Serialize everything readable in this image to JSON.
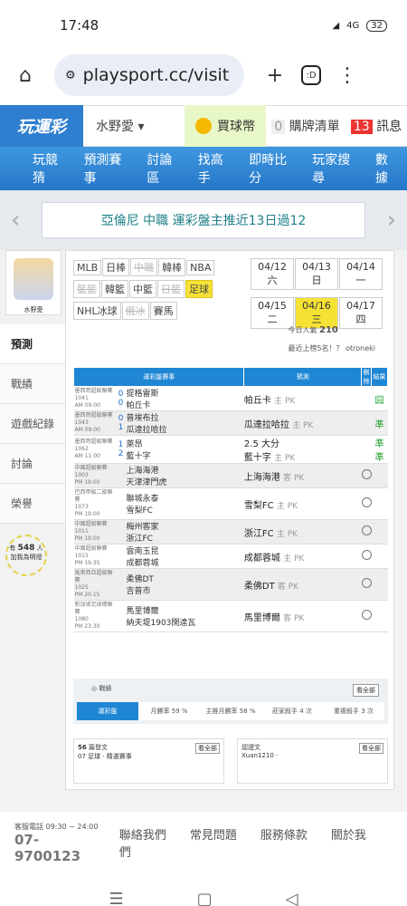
{
  "status": {
    "time": "17:48",
    "battery": "32",
    "net": "4G"
  },
  "browser": {
    "url": "playsport.cc/visit",
    "tab": ":D"
  },
  "site": {
    "logo": "玩運彩",
    "user": "水野愛",
    "coin": "買球幣",
    "cart_count": "0",
    "cart": "購牌清單",
    "msg_count": "13",
    "msg": "訊息"
  },
  "nav": [
    "玩競猜",
    "預測賽事",
    "討論區",
    "找高手",
    "即時比分",
    "玩家搜尋",
    "數據"
  ],
  "banner": {
    "text": "亞倫尼 中職 運彩盤主推近13日過12"
  },
  "side": {
    "name": "水野愛",
    "items": [
      "預測",
      "戰績",
      "遊戲紀錄",
      "討論",
      "榮譽"
    ],
    "bulb_top": "有",
    "bulb_count": "548",
    "bulb_unit": "人",
    "bulb_bottom": "加我為明燈"
  },
  "leagues": [
    {
      "n": "MLB"
    },
    {
      "n": "日棒"
    },
    {
      "n": "中職",
      "dis": true
    },
    {
      "n": "韓棒"
    },
    {
      "n": "NBA"
    },
    {
      "n": "籃籃",
      "dis": true
    },
    {
      "n": "韓籃"
    },
    {
      "n": "中籃"
    },
    {
      "n": "日籃",
      "dis": true
    },
    {
      "n": "足球",
      "y": true
    },
    {
      "n": "NHL冰球"
    },
    {
      "n": "俄冰",
      "dis": true
    },
    {
      "n": "賽馬"
    }
  ],
  "dates": [
    {
      "d": "04/12 六"
    },
    {
      "d": "04/13 日"
    },
    {
      "d": "04/14 一"
    },
    {
      "d": "04/15 二"
    },
    {
      "d": "04/16 三",
      "y": true
    },
    {
      "d": "04/17 四"
    }
  ],
  "pop": {
    "label": "今日人氣",
    "value": "210",
    "label2": "最近上榜5名！？ otroneki"
  },
  "table": {
    "h1": "運彩盤賽事",
    "h2": "預測",
    "h3": "刪除",
    "h4": "結果",
    "rows": [
      {
        "lg": "墨西哥超級聯賽",
        "code": "1041",
        "time": "AM 09:00",
        "n1": "0",
        "n2": "0",
        "a": "提格雷斯",
        "b": "帕丘卡",
        "pick": "帕丘卡",
        "side": "主 PK",
        "res": "囧",
        "gray": false
      },
      {
        "lg": "墨西哥超級聯賽",
        "code": "1043",
        "time": "AM 09:00",
        "n1": "0",
        "n2": "1",
        "a": "普埃布拉",
        "b": "瓜達拉哈拉",
        "pick": "瓜達拉哈拉",
        "side": "主 PK",
        "res": "準",
        "gray": true
      },
      {
        "lg": "墨西哥超級聯賽",
        "code": "1062",
        "time": "AM 11:00",
        "n1": "1",
        "n2": "2",
        "a": "萊昂",
        "b": "藍十字",
        "pick": "2.5 大分",
        "pick2": "藍十字",
        "side": "主 PK",
        "res": "準",
        "res2": "準",
        "gray": false
      },
      {
        "lg": "中國超級聯賽",
        "code": "1003",
        "time": "PM 19:00",
        "n1": "",
        "n2": "",
        "a": "上海海港",
        "b": "天津津門虎",
        "pick": "上海海港",
        "side": "客 PK",
        "res": "o",
        "gray": true
      },
      {
        "lg": "巴西甲級二級聯賽",
        "code": "1073",
        "time": "PM 19:00",
        "n1": "",
        "n2": "",
        "a": "聯城永泰",
        "b": "雪梨FC",
        "pick": "雪梨FC",
        "side": "主 PK",
        "res": "o",
        "gray": false
      },
      {
        "lg": "中國超級聯賽",
        "code": "1011",
        "time": "PM 19:00",
        "n1": "",
        "n2": "",
        "a": "梅州客家",
        "b": "浙江FC",
        "pick": "浙江FC",
        "side": "主 PK",
        "res": "o",
        "gray": true
      },
      {
        "lg": "中國超級聯賽",
        "code": "1015",
        "time": "PM 19:35",
        "n1": "",
        "n2": "",
        "a": "雲南玉昆",
        "b": "成都蓉城",
        "pick": "成都蓉城",
        "side": "主 PK",
        "res": "o",
        "gray": false
      },
      {
        "lg": "馬來西亞超級聯賽",
        "code": "1025",
        "time": "PM 20:15",
        "n1": "",
        "n2": "",
        "a": "柔佛DT",
        "b": "吉普市",
        "pick": "柔佛DT",
        "side": "客 PK",
        "res": "o",
        "gray": true
      },
      {
        "lg": "新加坡足球總聯賽",
        "code": "1080",
        "time": "PM 23:30",
        "n1": "",
        "n2": "",
        "a": "馬里博爾",
        "b": "納夫堤1903闊達瓦",
        "pick": "馬里博爾",
        "side": "客 PK",
        "res": "o",
        "gray": false
      }
    ]
  },
  "record": {
    "title": "戰績",
    "all": "看全部",
    "items": [
      "運彩盤",
      "月勝率 59 %",
      "主推月勝率 58 %",
      "莊家殺手 4 次",
      "重複殺手 3 次"
    ]
  },
  "cards": [
    {
      "count": "56",
      "title": "篇發文",
      "all": "看全部",
      "line": "07 足球 · 精選賽事"
    },
    {
      "title": "認證文",
      "all": "看全部",
      "line": "Xuan1210 ·"
    }
  ],
  "footer": {
    "hotline_label": "客服電話 09:30 ~ 24:00",
    "hotline": "07-9700123",
    "links": [
      "聯絡我們",
      "常見問題",
      "服務條款",
      "關於我們"
    ]
  },
  "sysnav": [
    "☰",
    "▢",
    "◁"
  ]
}
